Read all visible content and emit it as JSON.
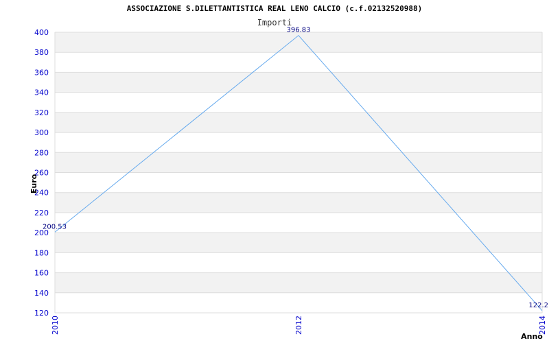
{
  "chart_data": {
    "type": "line",
    "title": "ASSOCIAZIONE S.DILETTANTISTICA REAL LENO CALCIO (c.f.02132520988)",
    "subtitle": "Importi",
    "xlabel": "Anno",
    "ylabel": "Euro",
    "x": [
      "2010",
      "2012",
      "2014"
    ],
    "series": [
      {
        "values": [
          200.53,
          396.83,
          122.2
        ]
      }
    ],
    "data_labels": [
      "200.53",
      "396.83",
      "122.2"
    ],
    "ylim": [
      120,
      400
    ],
    "yticks": [
      400,
      380,
      360,
      340,
      320,
      300,
      280,
      260,
      240,
      220,
      200,
      180,
      160,
      140,
      120
    ],
    "grid": true,
    "colors": {
      "line": "#66aaee",
      "band": "#f2f2f2",
      "grid": "#dddddd",
      "tick_text": "#0000cc",
      "data_label": "#000080"
    }
  }
}
